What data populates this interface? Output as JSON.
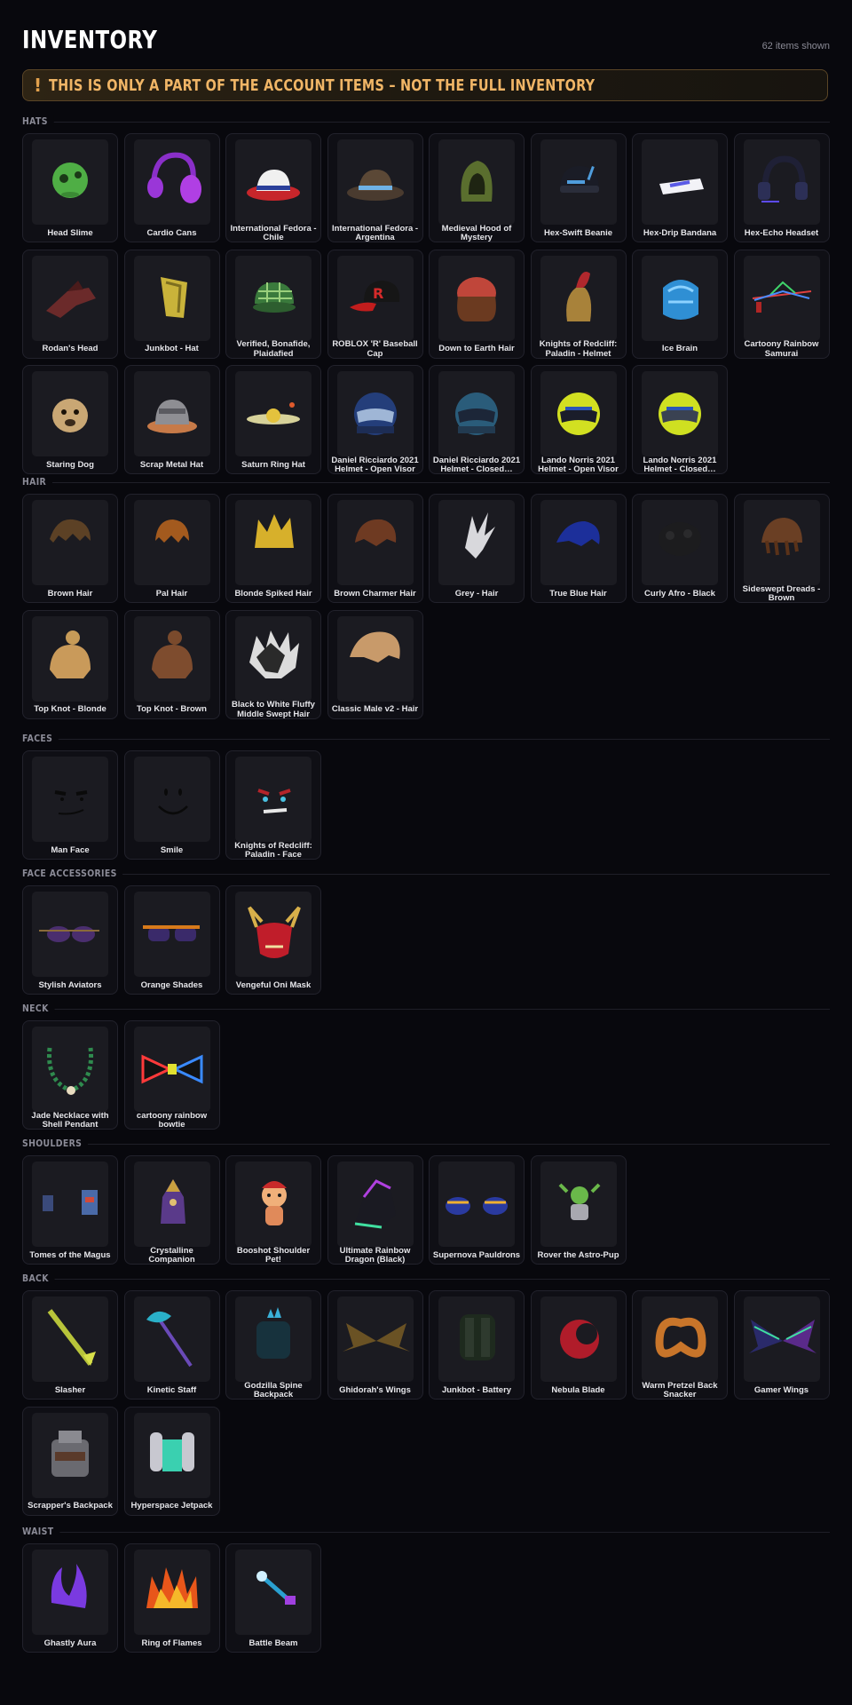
{
  "header": {
    "title": "INVENTORY",
    "count": "62 items shown",
    "banner_icon": "!",
    "banner_text": "THIS IS ONLY A PART OF THE ACCOUNT ITEMS – NOT THE FULL INVENTORY"
  },
  "sections": [
    {
      "title": "HATS",
      "items": [
        {
          "name": "Head Slime",
          "icon": "slime-head"
        },
        {
          "name": "Cardio Cans",
          "icon": "headphones-purple"
        },
        {
          "name": "International Fedora - Chile",
          "icon": "fedora-chile"
        },
        {
          "name": "International Fedora - Argentina",
          "icon": "fedora-argentina"
        },
        {
          "name": "Medieval Hood of Mystery",
          "icon": "green-hood"
        },
        {
          "name": "Hex-Swift Beanie",
          "icon": "beanie"
        },
        {
          "name": "Hex-Drip Bandana",
          "icon": "bandana"
        },
        {
          "name": "Hex-Echo Headset",
          "icon": "headset"
        },
        {
          "name": "Rodan's Head",
          "icon": "rodan-head"
        },
        {
          "name": "Junkbot - Hat",
          "icon": "junkbot-hat"
        },
        {
          "name": "Verified, Bonafide, Plaidafied",
          "icon": "plaid-cap"
        },
        {
          "name": "ROBLOX 'R' Baseball Cap",
          "icon": "r-cap"
        },
        {
          "name": "Down to Earth Hair",
          "icon": "earth-hair"
        },
        {
          "name": "Knights of Redcliff: Paladin - Helmet",
          "icon": "paladin-helmet"
        },
        {
          "name": "Ice Brain",
          "icon": "ice-brain"
        },
        {
          "name": "Cartoony Rainbow Samurai",
          "icon": "rainbow-samurai"
        },
        {
          "name": "Staring Dog",
          "icon": "dog-head"
        },
        {
          "name": "Scrap Metal Hat",
          "icon": "scrap-hat"
        },
        {
          "name": "Saturn Ring Hat",
          "icon": "saturn-hat"
        },
        {
          "name": "Daniel Ricciardo 2021 Helmet - Open Visor",
          "icon": "helmet-blue-open"
        },
        {
          "name": "Daniel Ricciardo 2021 Helmet - Closed…",
          "icon": "helmet-blue-closed"
        },
        {
          "name": "Lando Norris 2021 Helmet - Open Visor",
          "icon": "helmet-yellow-open"
        },
        {
          "name": "Lando Norris 2021 Helmet - Closed…",
          "icon": "helmet-yellow-closed"
        }
      ]
    },
    {
      "title": "HAIR",
      "items": [
        {
          "name": "Brown Hair",
          "icon": "hair-brown"
        },
        {
          "name": "Pal Hair",
          "icon": "hair-pal"
        },
        {
          "name": "Blonde Spiked Hair",
          "icon": "hair-blonde-spiked"
        },
        {
          "name": "Brown Charmer Hair",
          "icon": "hair-charmer"
        },
        {
          "name": "Grey - Hair",
          "icon": "hair-grey"
        },
        {
          "name": "True Blue Hair",
          "icon": "hair-blue"
        },
        {
          "name": "Curly Afro - Black",
          "icon": "hair-afro"
        },
        {
          "name": "Sideswept Dreads - Brown",
          "icon": "hair-dreads"
        },
        {
          "name": "Top Knot - Blonde",
          "icon": "hair-topknot-blonde"
        },
        {
          "name": "Top Knot - Brown",
          "icon": "hair-topknot-brown"
        },
        {
          "name": "Black to White Fluffy Middle Swept Hair",
          "icon": "hair-fluffy"
        },
        {
          "name": "Classic Male v2 - Hair",
          "icon": "hair-classic"
        }
      ]
    },
    {
      "title": "FACES",
      "items": [
        {
          "name": "Man Face",
          "icon": "man-face"
        },
        {
          "name": "Smile",
          "icon": "smile-face"
        },
        {
          "name": "Knights of Redcliff: Paladin - Face",
          "icon": "paladin-face"
        }
      ]
    },
    {
      "title": "FACE ACCESSORIES",
      "items": [
        {
          "name": "Stylish Aviators",
          "icon": "aviators"
        },
        {
          "name": "Orange Shades",
          "icon": "orange-shades"
        },
        {
          "name": "Vengeful Oni Mask",
          "icon": "oni-mask"
        }
      ]
    },
    {
      "title": "NECK",
      "items": [
        {
          "name": "Jade Necklace with Shell Pendant",
          "icon": "jade-necklace"
        },
        {
          "name": "cartoony rainbow bowtie",
          "icon": "rainbow-bowtie"
        }
      ]
    },
    {
      "title": "SHOULDERS",
      "items": [
        {
          "name": "Tomes of the Magus",
          "icon": "tomes"
        },
        {
          "name": "Crystalline Companion",
          "icon": "crystal-companion"
        },
        {
          "name": "Booshot Shoulder Pet!",
          "icon": "booshot-pet"
        },
        {
          "name": "Ultimate Rainbow Dragon (Black)",
          "icon": "rainbow-dragon"
        },
        {
          "name": "Supernova Pauldrons",
          "icon": "pauldrons"
        },
        {
          "name": "Rover the Astro-Pup",
          "icon": "astro-pup"
        }
      ]
    },
    {
      "title": "BACK",
      "items": [
        {
          "name": "Slasher",
          "icon": "slasher"
        },
        {
          "name": "Kinetic Staff",
          "icon": "kinetic-staff"
        },
        {
          "name": "Godzilla Spine Backpack",
          "icon": "godzilla-backpack"
        },
        {
          "name": "Ghidorah's Wings",
          "icon": "ghidorah-wings"
        },
        {
          "name": "Junkbot - Battery",
          "icon": "junkbot-battery"
        },
        {
          "name": "Nebula Blade",
          "icon": "nebula-blade"
        },
        {
          "name": "Warm Pretzel Back Snacker",
          "icon": "pretzel"
        },
        {
          "name": "Gamer Wings",
          "icon": "gamer-wings"
        },
        {
          "name": "Scrapper's Backpack",
          "icon": "scrapper-backpack"
        },
        {
          "name": "Hyperspace Jetpack",
          "icon": "jetpack"
        }
      ]
    },
    {
      "title": "WAIST",
      "items": [
        {
          "name": "Ghastly Aura",
          "icon": "ghastly-aura"
        },
        {
          "name": "Ring of Flames",
          "icon": "ring-of-flames"
        },
        {
          "name": "Battle Beam",
          "icon": "battle-beam"
        }
      ]
    }
  ]
}
